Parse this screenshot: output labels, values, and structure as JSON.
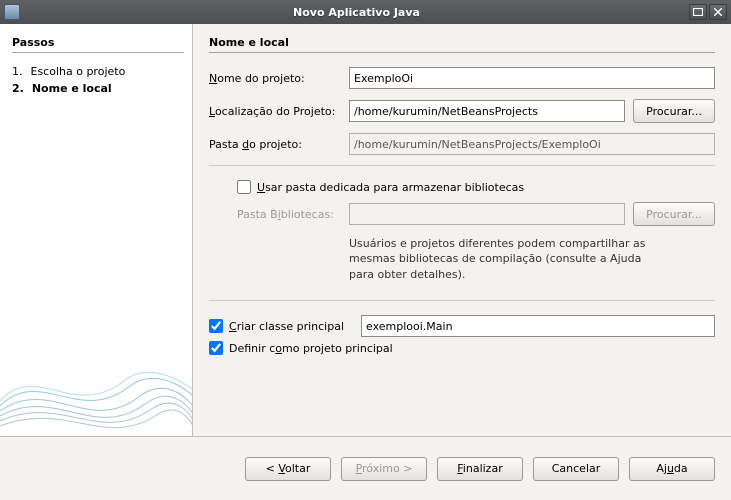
{
  "titlebar": {
    "title": "Novo Aplicativo Java"
  },
  "sidebar": {
    "heading": "Passos",
    "steps": [
      {
        "num": "1.",
        "label": "Escolha o projeto"
      },
      {
        "num": "2.",
        "label": "Nome e local"
      }
    ],
    "current_step_index": 1
  },
  "main": {
    "heading": "Nome e local",
    "project_name_label": "Nome do projeto:",
    "project_name_value": "ExemploOi",
    "location_label": "Localização do Projeto:",
    "location_value": "/home/kurumin/NetBeansProjects",
    "browse_label": "Procurar...",
    "folder_label": "Pasta do projeto:",
    "folder_value": "/home/kurumin/NetBeansProjects/ExemploOi",
    "use_dedicated_label": "Usar pasta dedicada para armazenar bibliotecas",
    "use_dedicated_checked": false,
    "lib_folder_label": "Pasta Bibliotecas:",
    "lib_folder_value": "",
    "lib_browse_label": "Procurar...",
    "helper_text": "Usuários e projetos diferentes podem compartilhar as mesmas bibliotecas de compilação (consulte a Ajuda para obter detalhes).",
    "create_main_label": "Criar classe principal",
    "create_main_checked": true,
    "main_class_value": "exemplooi.Main",
    "set_main_label": "Definir como projeto principal",
    "set_main_checked": true
  },
  "footer": {
    "back": "< Voltar",
    "next": "Próximo >",
    "finish": "Finalizar",
    "cancel": "Cancelar",
    "help": "Ajuda"
  }
}
